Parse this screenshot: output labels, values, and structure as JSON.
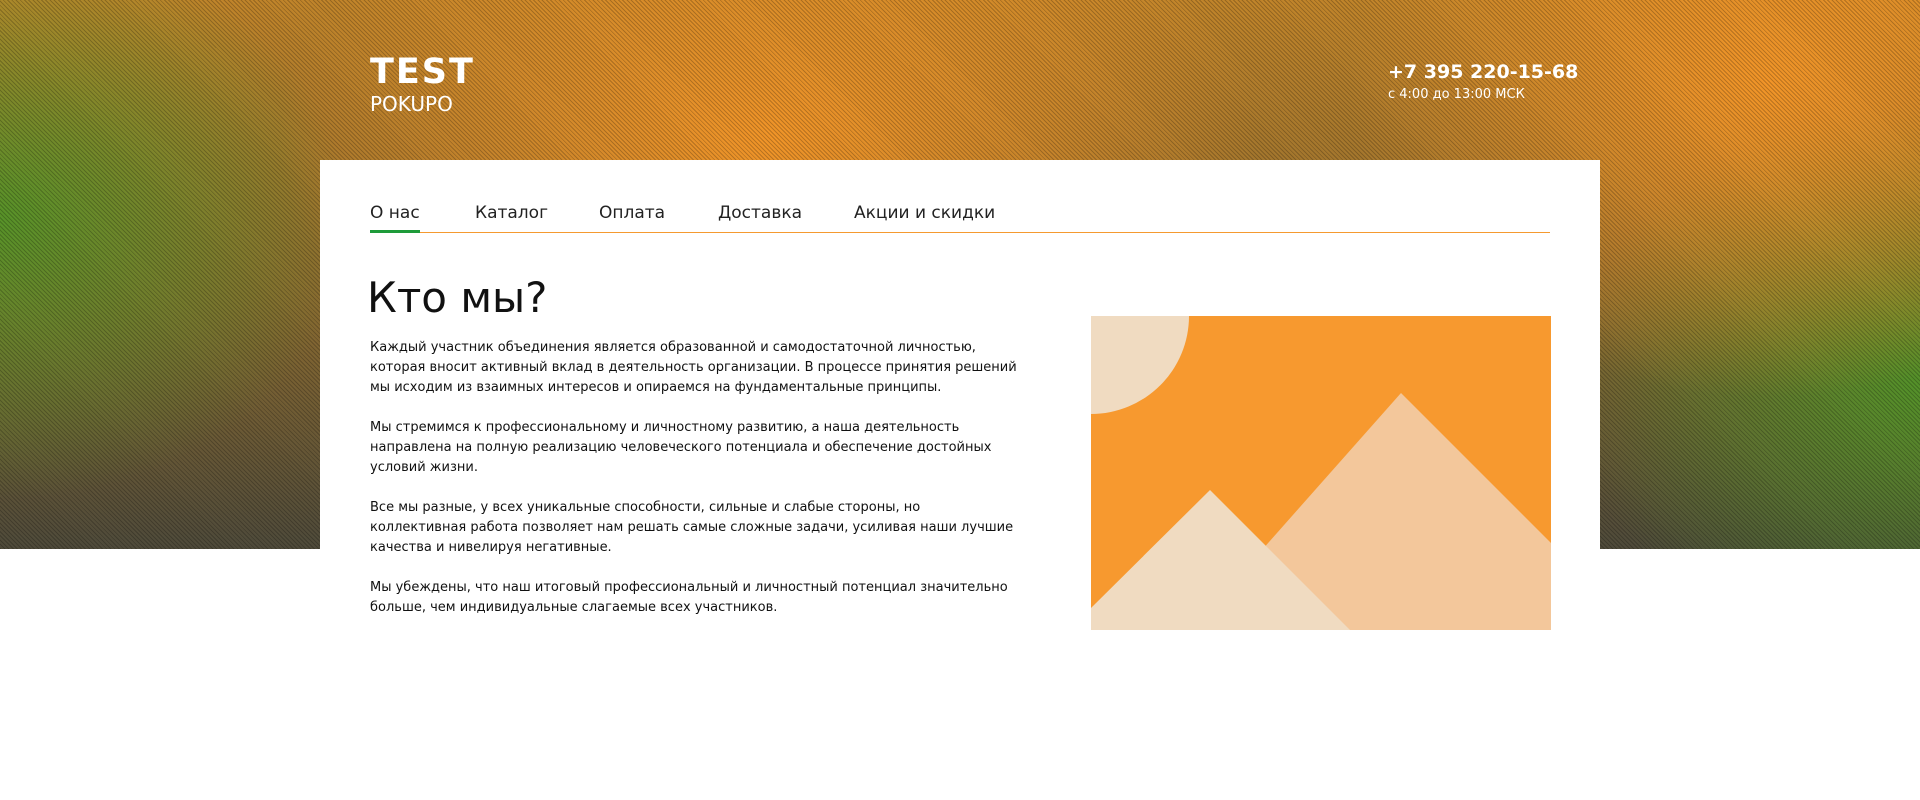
{
  "header": {
    "logo_top": "TEST",
    "logo_bottom": "POKUPO",
    "phone": "+7 395 220-15-68",
    "hours": "с 4:00 до 13:00 МСК"
  },
  "nav": {
    "items": [
      {
        "label": "О нас",
        "active": true
      },
      {
        "label": "Каталог",
        "active": false
      },
      {
        "label": "Оплата",
        "active": false
      },
      {
        "label": "Доставка",
        "active": false
      },
      {
        "label": "Акции и скидки",
        "active": false
      }
    ]
  },
  "main": {
    "heading": "Кто мы?",
    "paragraphs": [
      "Каждый участник объединения является образованной и самодостаточной личностью, которая вносит активный вклад в деятельность организации. В процессе принятия решений мы исходим из взаимных интересов и опираемся на фундаментальные принципы.",
      "Мы стремимся к профессиональному и личностному развитию, а наша деятельность направлена на полную реализацию человеческого потенциала и обеспечение достойных условий жизни.",
      "Все мы разные, у всех уникальные способности, сильные и слабые стороны, но коллективная работа позволяет нам решать самые сложные задачи, усиливая наши лучшие качества и нивелируя негативные.",
      "Мы убеждены, что наш итоговый профессиональный и личностный потенциал значительно больше, чем индивидуальные слагаемые всех участников."
    ]
  },
  "illustration": {
    "icon": "image-placeholder-icon",
    "colors": {
      "background": "#f7992f",
      "sun": "#f0dbc1",
      "mountain_back": "#f3c79b",
      "mountain_front": "#f0dbc1"
    }
  },
  "colors": {
    "accent_orange": "#f59a2f",
    "accent_green": "#1e9b3a"
  }
}
